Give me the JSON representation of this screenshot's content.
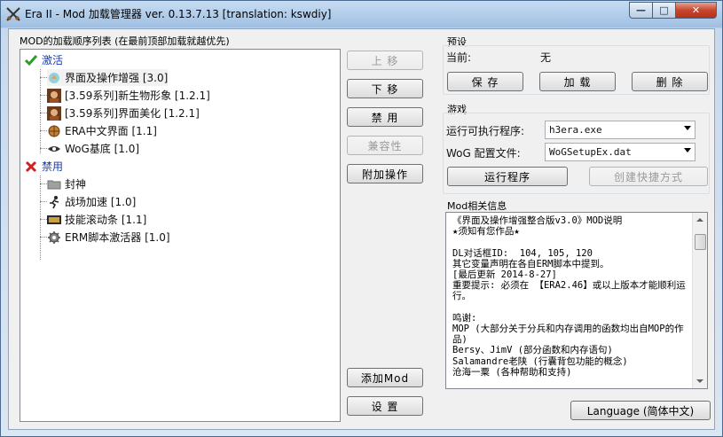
{
  "window": {
    "title": "Era II - Mod 加载管理器 ver. 0.13.7.13 [translation: kswdiy]",
    "caption_min": "—",
    "caption_max": "□",
    "caption_close": "✕"
  },
  "mod_list": {
    "group_label": "MOD的加载顺序列表 (在最前顶部加载就越优先)",
    "active_label": "激活",
    "disabled_label": "禁用",
    "active_items": [
      {
        "label": "界面及操作增强 [3.0]",
        "icon": "hand-icon"
      },
      {
        "label": "[3.59系列]新生物形象 [1.2.1]",
        "icon": "portrait-icon"
      },
      {
        "label": "[3.59系列]界面美化 [1.2.1]",
        "icon": "portrait-icon"
      },
      {
        "label": "ERA中文界面 [1.1]",
        "icon": "globe-icon"
      },
      {
        "label": "WoG基底 [1.0]",
        "icon": "eye-icon"
      }
    ],
    "disabled_items": [
      {
        "label": "封神",
        "icon": "folder-icon"
      },
      {
        "label": "战场加速 [1.0]",
        "icon": "runner-icon"
      },
      {
        "label": "技能滚动条 [1.1]",
        "icon": "scroll-bar-icon"
      },
      {
        "label": "ERM脚本激活器 [1.0]",
        "icon": "gear-icon"
      }
    ]
  },
  "side_buttons": {
    "move_up": "上 移",
    "move_down": "下 移",
    "disable": "禁 用",
    "compat": "兼容性",
    "extra": "附加操作",
    "add_mod": "添加Mod",
    "settings": "设 置"
  },
  "preset": {
    "group_label": "预设",
    "current_label": "当前:",
    "current_value": "无",
    "save": "保 存",
    "load": "加 载",
    "delete": "删 除"
  },
  "game": {
    "group_label": "游戏",
    "exe_label": "运行可执行程序:",
    "exe_value": "h3era.exe",
    "config_label": "WoG 配置文件:",
    "config_value": "WoGSetupEx.dat",
    "run": "运行程序",
    "shortcut": "创建快捷方式"
  },
  "mod_info": {
    "group_label": "Mod相关信息",
    "text": "《界面及操作增强整合版v3.0》MOD说明\n★须知有您作品★\n\nDL对话框ID:  104, 105, 120\n其它变量声明在各自ERM脚本中提到。\n[最后更新 2014-8-27]\n重要提示: 必须在 【ERA2.46】或以上版本才能顺利运行。\n\n鸣谢:\nMOP (大部分关于分兵和内存调用的函数均出自MOP的作品)\nBersy、JimV (部分函数和内存语句)\nSalamandre老陕 (行囊背包功能的概念)\n沧海一粟 (各种帮助和支持)"
  },
  "language_button": "Language (简体中文)"
}
